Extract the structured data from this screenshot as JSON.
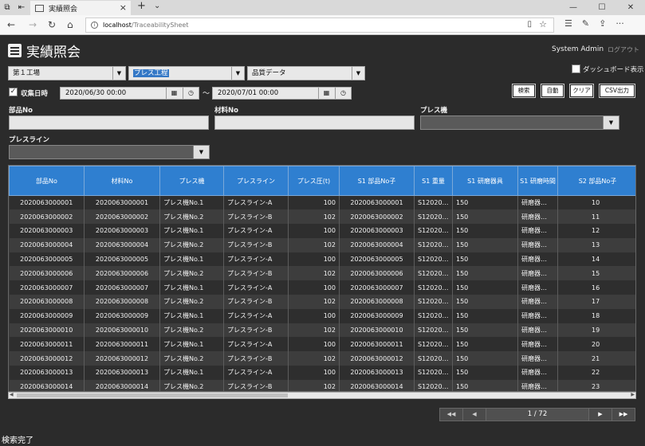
{
  "browser": {
    "tab_title": "実績照会",
    "url_host": "localhost",
    "url_path": "/TraceabilitySheet"
  },
  "app": {
    "title": "実績照会",
    "user": "System Admin",
    "logout": "ログアウト"
  },
  "filters": {
    "factory": "第１工場",
    "process": "プレス工程",
    "datatype": "品質データ",
    "dashboard_label": "ダッシュボード表示",
    "collect_label": "収集日時",
    "date_from": "2020/06/30 00:00",
    "date_to": "2020/07/01 00:00",
    "tilde": "～",
    "part_no_label": "部品No",
    "material_no_label": "材料No",
    "press_machine_label": "プレス機",
    "press_line_label": "プレスライン"
  },
  "buttons": {
    "search": "検索",
    "auto": "自動",
    "clear": "クリア",
    "csv": "CSV出力"
  },
  "table": {
    "headers": [
      "部品No",
      "材料No",
      "プレス機",
      "プレスライン",
      "プレス圧(t)",
      "S1 部品No子",
      "S1 重量",
      "S1 研磨器具",
      "S1 研磨時間",
      "S2 部品No子"
    ],
    "rows": [
      [
        "2020063000001",
        "2020063000001",
        "プレス機No.1",
        "プレスライン-A",
        "100",
        "2020063000001",
        "S12020…",
        "150",
        "研磨器…",
        "10"
      ],
      [
        "2020063000002",
        "2020063000002",
        "プレス機No.2",
        "プレスライン-B",
        "102",
        "2020063000002",
        "S12020…",
        "150",
        "研磨器…",
        "11"
      ],
      [
        "2020063000003",
        "2020063000003",
        "プレス機No.1",
        "プレスライン-A",
        "100",
        "2020063000003",
        "S12020…",
        "150",
        "研磨器…",
        "12"
      ],
      [
        "2020063000004",
        "2020063000004",
        "プレス機No.2",
        "プレスライン-B",
        "102",
        "2020063000004",
        "S12020…",
        "150",
        "研磨器…",
        "13"
      ],
      [
        "2020063000005",
        "2020063000005",
        "プレス機No.1",
        "プレスライン-A",
        "100",
        "2020063000005",
        "S12020…",
        "150",
        "研磨器…",
        "14"
      ],
      [
        "2020063000006",
        "2020063000006",
        "プレス機No.2",
        "プレスライン-B",
        "102",
        "2020063000006",
        "S12020…",
        "150",
        "研磨器…",
        "15"
      ],
      [
        "2020063000007",
        "2020063000007",
        "プレス機No.1",
        "プレスライン-A",
        "100",
        "2020063000007",
        "S12020…",
        "150",
        "研磨器…",
        "16"
      ],
      [
        "2020063000008",
        "2020063000008",
        "プレス機No.2",
        "プレスライン-B",
        "102",
        "2020063000008",
        "S12020…",
        "150",
        "研磨器…",
        "17"
      ],
      [
        "2020063000009",
        "2020063000009",
        "プレス機No.1",
        "プレスライン-A",
        "100",
        "2020063000009",
        "S12020…",
        "150",
        "研磨器…",
        "18"
      ],
      [
        "2020063000010",
        "2020063000010",
        "プレス機No.2",
        "プレスライン-B",
        "102",
        "2020063000010",
        "S12020…",
        "150",
        "研磨器…",
        "19"
      ],
      [
        "2020063000011",
        "2020063000011",
        "プレス機No.1",
        "プレスライン-A",
        "100",
        "2020063000011",
        "S12020…",
        "150",
        "研磨器…",
        "20"
      ],
      [
        "2020063000012",
        "2020063000012",
        "プレス機No.2",
        "プレスライン-B",
        "102",
        "2020063000012",
        "S12020…",
        "150",
        "研磨器…",
        "21"
      ],
      [
        "2020063000013",
        "2020063000013",
        "プレス機No.1",
        "プレスライン-A",
        "100",
        "2020063000013",
        "S12020…",
        "150",
        "研磨器…",
        "22"
      ],
      [
        "2020063000014",
        "2020063000014",
        "プレス機No.2",
        "プレスライン-B",
        "102",
        "2020063000014",
        "S12020…",
        "150",
        "研磨器…",
        "23"
      ]
    ]
  },
  "pager": {
    "page_text": "1 / 72"
  },
  "status": "検索完了"
}
